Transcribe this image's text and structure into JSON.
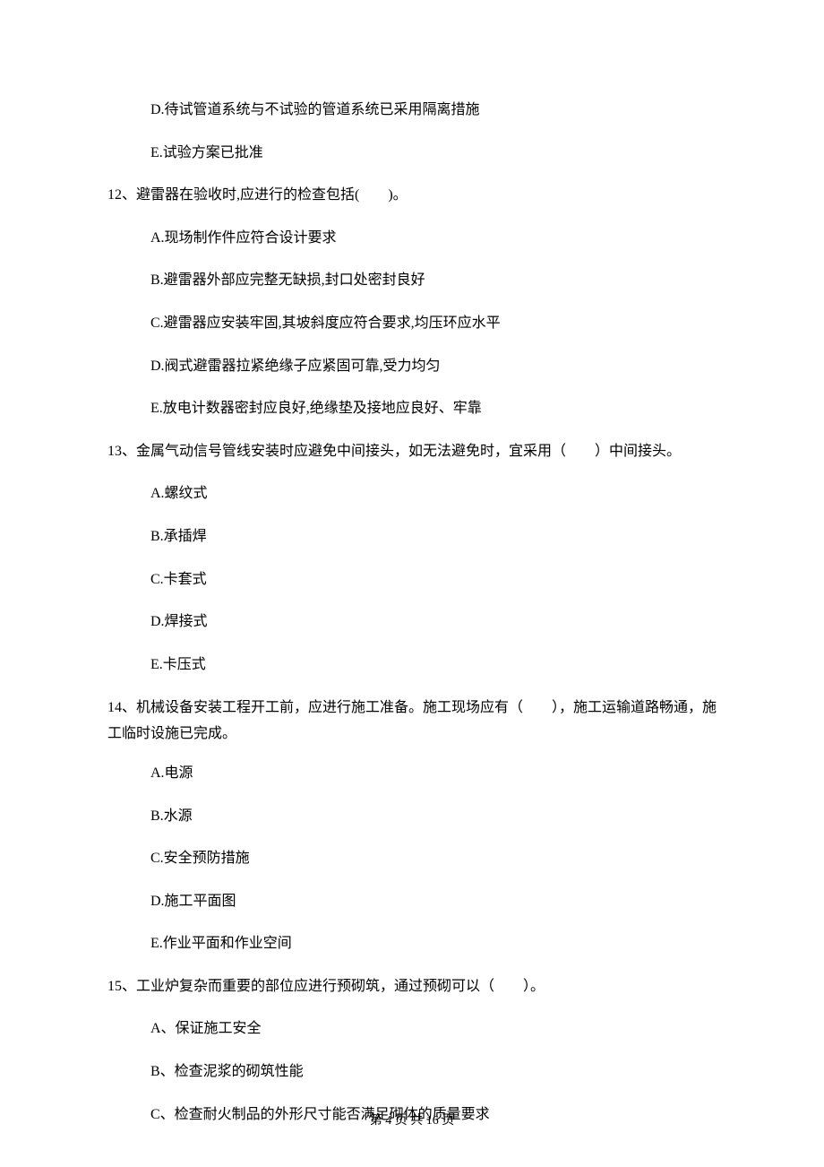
{
  "prev_options": {
    "D": "D.待试管道系统与不试验的管道系统已采用隔离措施",
    "E": "E.试验方案已批准"
  },
  "q12": {
    "stem": "12、避雷器在验收时,应进行的检查包括(　　)。",
    "A": "A.现场制作件应符合设计要求",
    "B": "B.避雷器外部应完整无缺损,封口处密封良好",
    "C": "C.避雷器应安装牢固,其坡斜度应符合要求,均压环应水平",
    "D": "D.阀式避雷器拉紧绝缘子应紧固可靠,受力均匀",
    "E": "E.放电计数器密封应良好,绝缘垫及接地应良好、牢靠"
  },
  "q13": {
    "stem": "13、金属气动信号管线安装时应避免中间接头，如无法避免时，宜采用（　　）中间接头。",
    "A": "A.螺纹式",
    "B": "B.承插焊",
    "C": "C.卡套式",
    "D": "D.焊接式",
    "E": "E.卡压式"
  },
  "q14": {
    "stem": "14、机械设备安装工程开工前，应进行施工准备。施工现场应有（　　），施工运输道路畅通，施工临时设施已完成。",
    "A": "A.电源",
    "B": "B.水源",
    "C": "C.安全预防措施",
    "D": "D.施工平面图",
    "E": "E.作业平面和作业空间"
  },
  "q15": {
    "stem": "15、工业炉复杂而重要的部位应进行预砌筑，通过预砌可以（　　）。",
    "A": "A、保证施工安全",
    "B": "B、检查泥浆的砌筑性能",
    "C": "C、检查耐火制品的外形尺寸能否满足砌体的质量要求"
  },
  "footer": "第 4 页 共 16 页"
}
